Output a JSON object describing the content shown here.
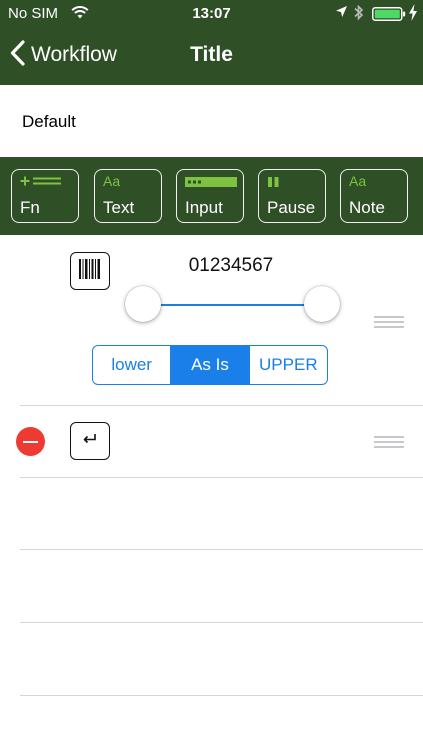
{
  "status_bar": {
    "carrier": "No SIM",
    "time": "13:07",
    "icons": [
      "wifi-icon",
      "location-arrow-icon",
      "bluetooth-icon",
      "battery-icon",
      "charging-bolt-icon"
    ]
  },
  "nav": {
    "back_label": "Workflow",
    "title": "Title"
  },
  "default_row": {
    "label": "Default"
  },
  "toolbar": {
    "items": [
      {
        "label": "Fn",
        "icon": "plus-lines-icon"
      },
      {
        "label": "Text",
        "icon": "aa-icon",
        "icon_text": "Aa"
      },
      {
        "label": "Input",
        "icon": "input-field-icon"
      },
      {
        "label": "Pause",
        "icon": "pause-icon"
      },
      {
        "label": "Note",
        "icon": "aa-icon",
        "icon_text": "Aa"
      }
    ]
  },
  "steps": [
    {
      "type": "barcode",
      "icon": "barcode-icon",
      "value": "01234567",
      "case_options": [
        "lower",
        "As Is",
        "UPPER"
      ],
      "selected_case": "As Is"
    },
    {
      "type": "return",
      "icon": "return-key-icon"
    }
  ],
  "colors": {
    "header_bg": "#2f4f26",
    "icon_accent": "#7fc242",
    "accent_blue": "#1a7fe8",
    "delete_red": "#ee3a33"
  }
}
